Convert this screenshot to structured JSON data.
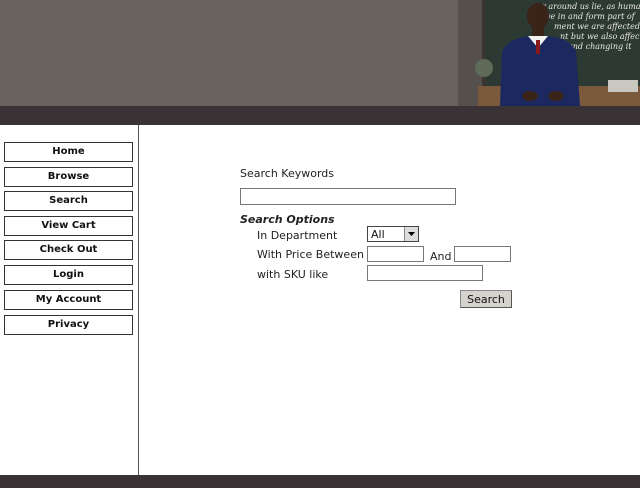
{
  "header": {
    "photo_description_icon": "teacher-photo",
    "chalkboard_lines": [
      "r around us lie, as huma",
      "ve in and form part of",
      "ment we are affected b",
      "nt but we also affect",
      "and changing it"
    ]
  },
  "sidebar": {
    "items": [
      {
        "label": "Home"
      },
      {
        "label": "Browse"
      },
      {
        "label": "Search"
      },
      {
        "label": "View Cart"
      },
      {
        "label": "Check Out"
      },
      {
        "label": "Login"
      },
      {
        "label": "My Account"
      },
      {
        "label": "Privacy"
      }
    ]
  },
  "search": {
    "keywords_label": "Search Keywords",
    "keywords_value": "",
    "options_heading": "Search Options",
    "department_label": "In Department",
    "department_value": "All",
    "price_label": "With Price Between",
    "price_and_label": "And",
    "price_min_value": "",
    "price_max_value": "",
    "sku_label": "with SKU like",
    "sku_value": "",
    "search_button_label": "Search"
  },
  "colors": {
    "header": "#6a625e",
    "dark_bar": "#3a3234",
    "button_face": "#d6d3cf"
  }
}
